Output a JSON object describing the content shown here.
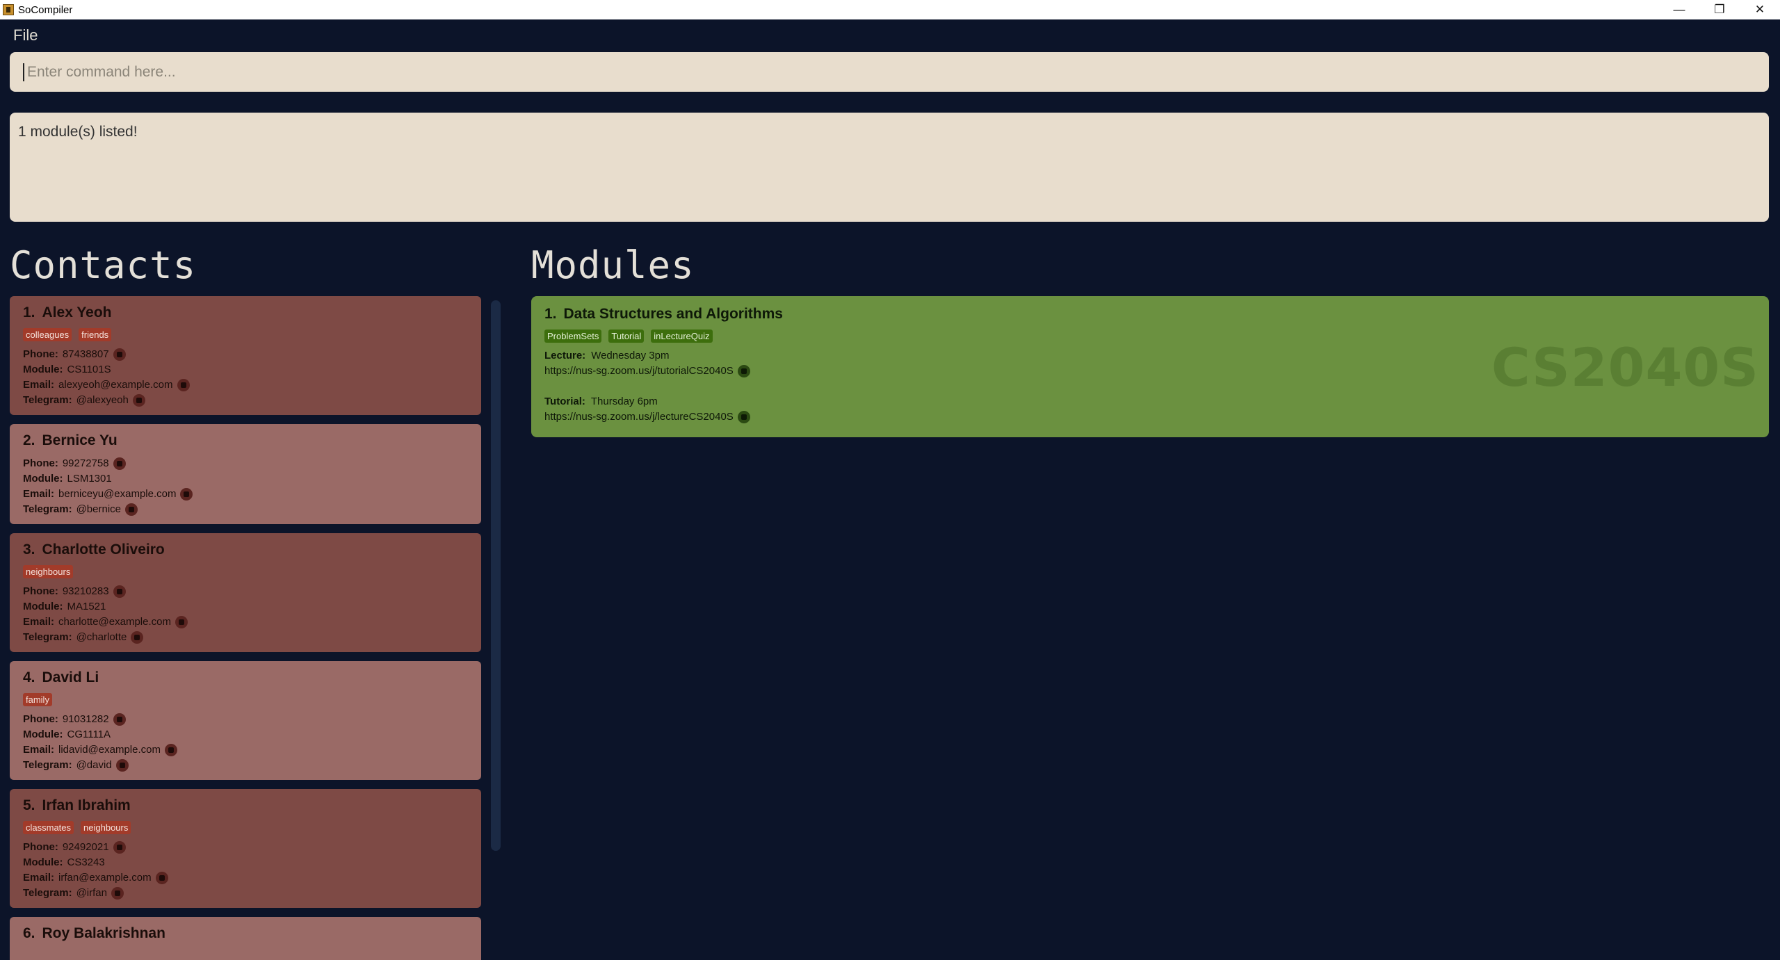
{
  "window": {
    "title": "SoCompiler",
    "minimize": "—",
    "restore": "❐",
    "close": "✕"
  },
  "menu": {
    "file": "File"
  },
  "command": {
    "placeholder": "Enter command here..."
  },
  "result": {
    "text": "1 module(s) listed!"
  },
  "sections": {
    "contacts": "Contacts",
    "modules": "Modules"
  },
  "labels": {
    "phone": "Phone:",
    "module": "Module:",
    "email": "Email:",
    "telegram": "Telegram:",
    "lecture": "Lecture:",
    "tutorial": "Tutorial:"
  },
  "contacts": [
    {
      "index": "1.",
      "name": "Alex Yeoh",
      "tags": [
        "colleagues",
        "friends"
      ],
      "phone": "87438807",
      "module": "CS1101S",
      "email": "alexyeoh@example.com",
      "telegram": "@alexyeoh"
    },
    {
      "index": "2.",
      "name": "Bernice Yu",
      "tags": [],
      "phone": "99272758",
      "module": "LSM1301",
      "email": "berniceyu@example.com",
      "telegram": "@bernice"
    },
    {
      "index": "3.",
      "name": "Charlotte Oliveiro",
      "tags": [
        "neighbours"
      ],
      "phone": "93210283",
      "module": "MA1521",
      "email": "charlotte@example.com",
      "telegram": "@charlotte"
    },
    {
      "index": "4.",
      "name": "David Li",
      "tags": [
        "family"
      ],
      "phone": "91031282",
      "module": "CG1111A",
      "email": "lidavid@example.com",
      "telegram": "@david"
    },
    {
      "index": "5.",
      "name": "Irfan Ibrahim",
      "tags": [
        "classmates",
        "neighbours"
      ],
      "phone": "92492021",
      "module": "CS3243",
      "email": "irfan@example.com",
      "telegram": "@irfan"
    },
    {
      "index": "6.",
      "name": "Roy Balakrishnan"
    }
  ],
  "modules": [
    {
      "index": "1.",
      "name": "Data Structures and Algorithms",
      "code": "CS2040S",
      "tags": [
        "ProblemSets",
        "Tutorial",
        "inLectureQuiz"
      ],
      "lecture_time": "Wednesday 3pm",
      "lecture_link": "https://nus-sg.zoom.us/j/tutorialCS2040S",
      "tutorial_time": "Thursday 6pm",
      "tutorial_link": "https://nus-sg.zoom.us/j/lectureCS2040S"
    }
  ],
  "colors": {
    "background": "#0c1429",
    "contact_card_dark": "#7e4a45",
    "contact_card_light": "#9a6a66",
    "contact_tag": "#a23b2a",
    "module_card": "#6b9140",
    "module_tag": "#3d6e0d",
    "input_bg": "#e8ddcd"
  }
}
